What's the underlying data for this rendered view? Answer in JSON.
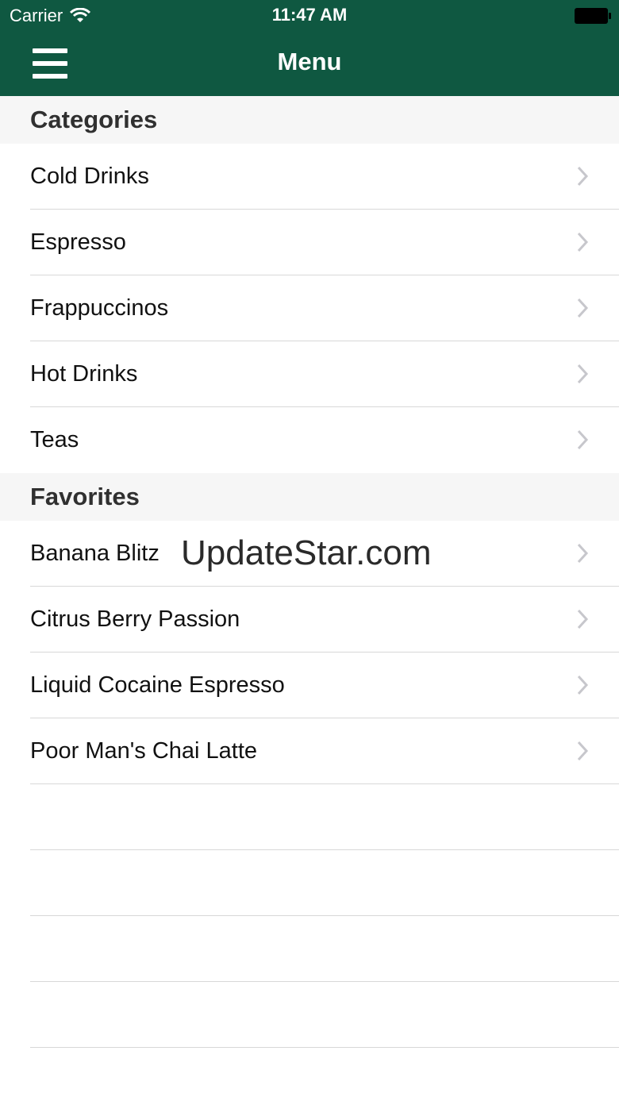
{
  "status_bar": {
    "carrier": "Carrier",
    "time": "11:47 AM"
  },
  "nav_bar": {
    "title": "Menu",
    "background": "#0f5841"
  },
  "sections": [
    {
      "header": "Categories",
      "items": [
        "Cold Drinks",
        "Espresso",
        "Frappuccinos",
        "Hot Drinks",
        "Teas"
      ]
    },
    {
      "header": "Favorites",
      "items": [
        "Banana Blitz",
        "Citrus Berry Passion",
        "Liquid Cocaine Espresso",
        "Poor Man's Chai Latte"
      ]
    }
  ],
  "watermark": "UpdateStar.com"
}
